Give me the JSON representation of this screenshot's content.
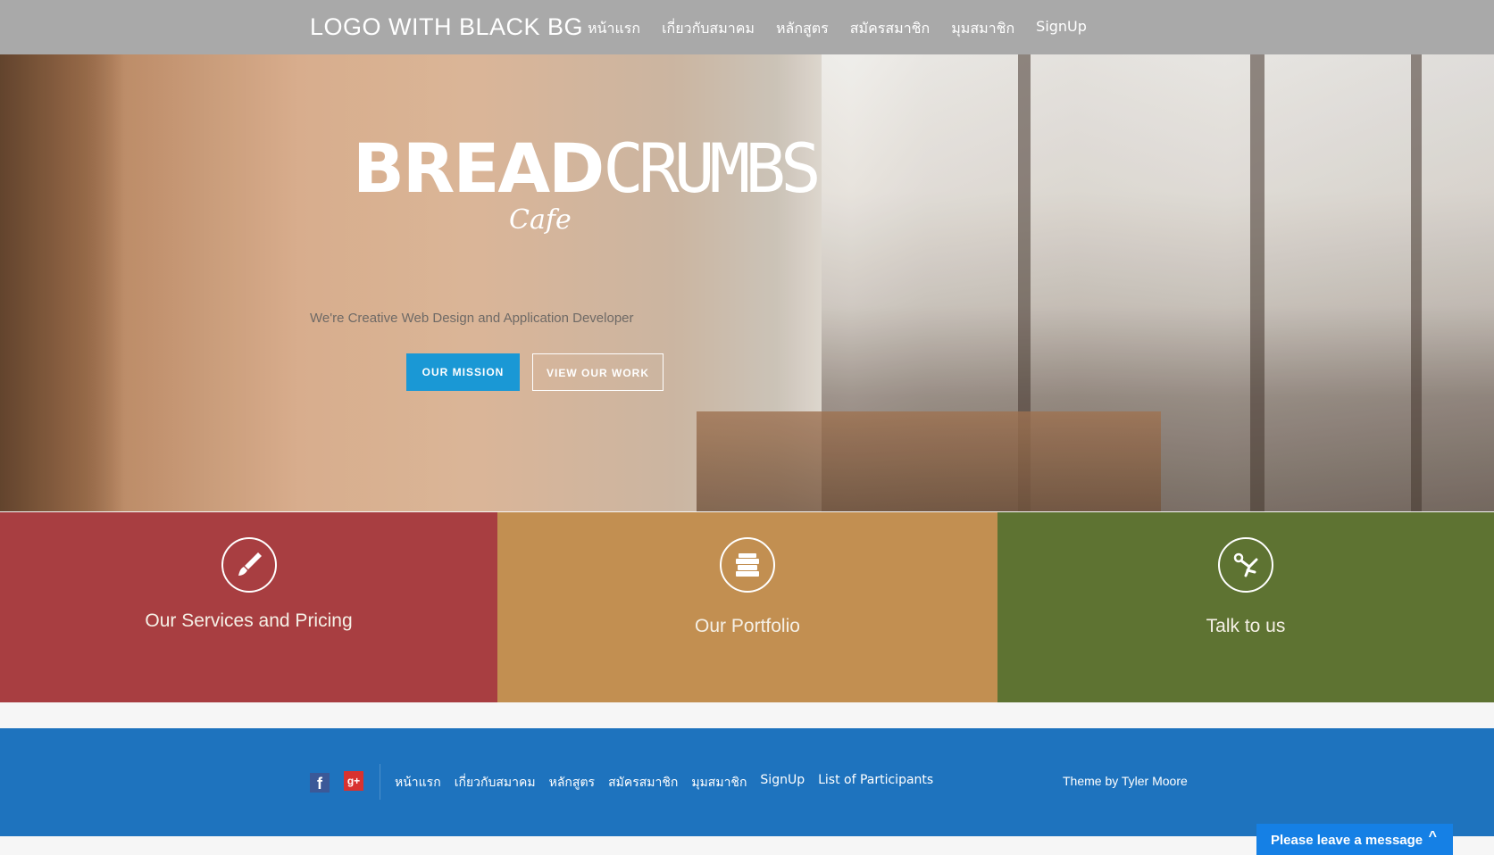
{
  "nav": {
    "logo": "LOGO WITH BLACK BG",
    "links": [
      "หน้าแรก",
      "เกี่ยวกับสมาคม",
      "หลักสูตร",
      "สมัครสมาชิก",
      "มุมสมาชิก",
      "SignUp"
    ]
  },
  "hero": {
    "brand_main_bold": "BREAD",
    "brand_main_thin": "CRUMBS",
    "brand_sub": "Cafe",
    "tagline": "We're Creative Web Design and Application Developer",
    "btn_mission": "OUR MISSION",
    "btn_work": "VIEW OUR WORK"
  },
  "tiles": [
    {
      "label": "Our Services and Pricing",
      "icon": "brush-icon",
      "color": "#a83e41"
    },
    {
      "label": "Our Portfolio",
      "icon": "stack-icon",
      "color": "#c28f51"
    },
    {
      "label": "Talk to us",
      "icon": "kick-icon",
      "color": "#5e7332"
    }
  ],
  "footer": {
    "social": {
      "facebook": "f",
      "googleplus": "g+"
    },
    "links": [
      "หน้าแรก",
      "เกี่ยวกับสมาคม",
      "หลักสูตร",
      "สมัครสมาชิก",
      "มุมสมาชิก",
      "SignUp",
      "List of Participants"
    ],
    "theme_credit": "Theme by Tyler Moore"
  },
  "chat": {
    "label": "Please leave a message",
    "chevron": "^"
  },
  "colors": {
    "nav_bg": "#a9a9a9",
    "accent_blue": "#1a98d5",
    "footer_bg": "#1e73be",
    "chat_bg": "#1580e5"
  }
}
